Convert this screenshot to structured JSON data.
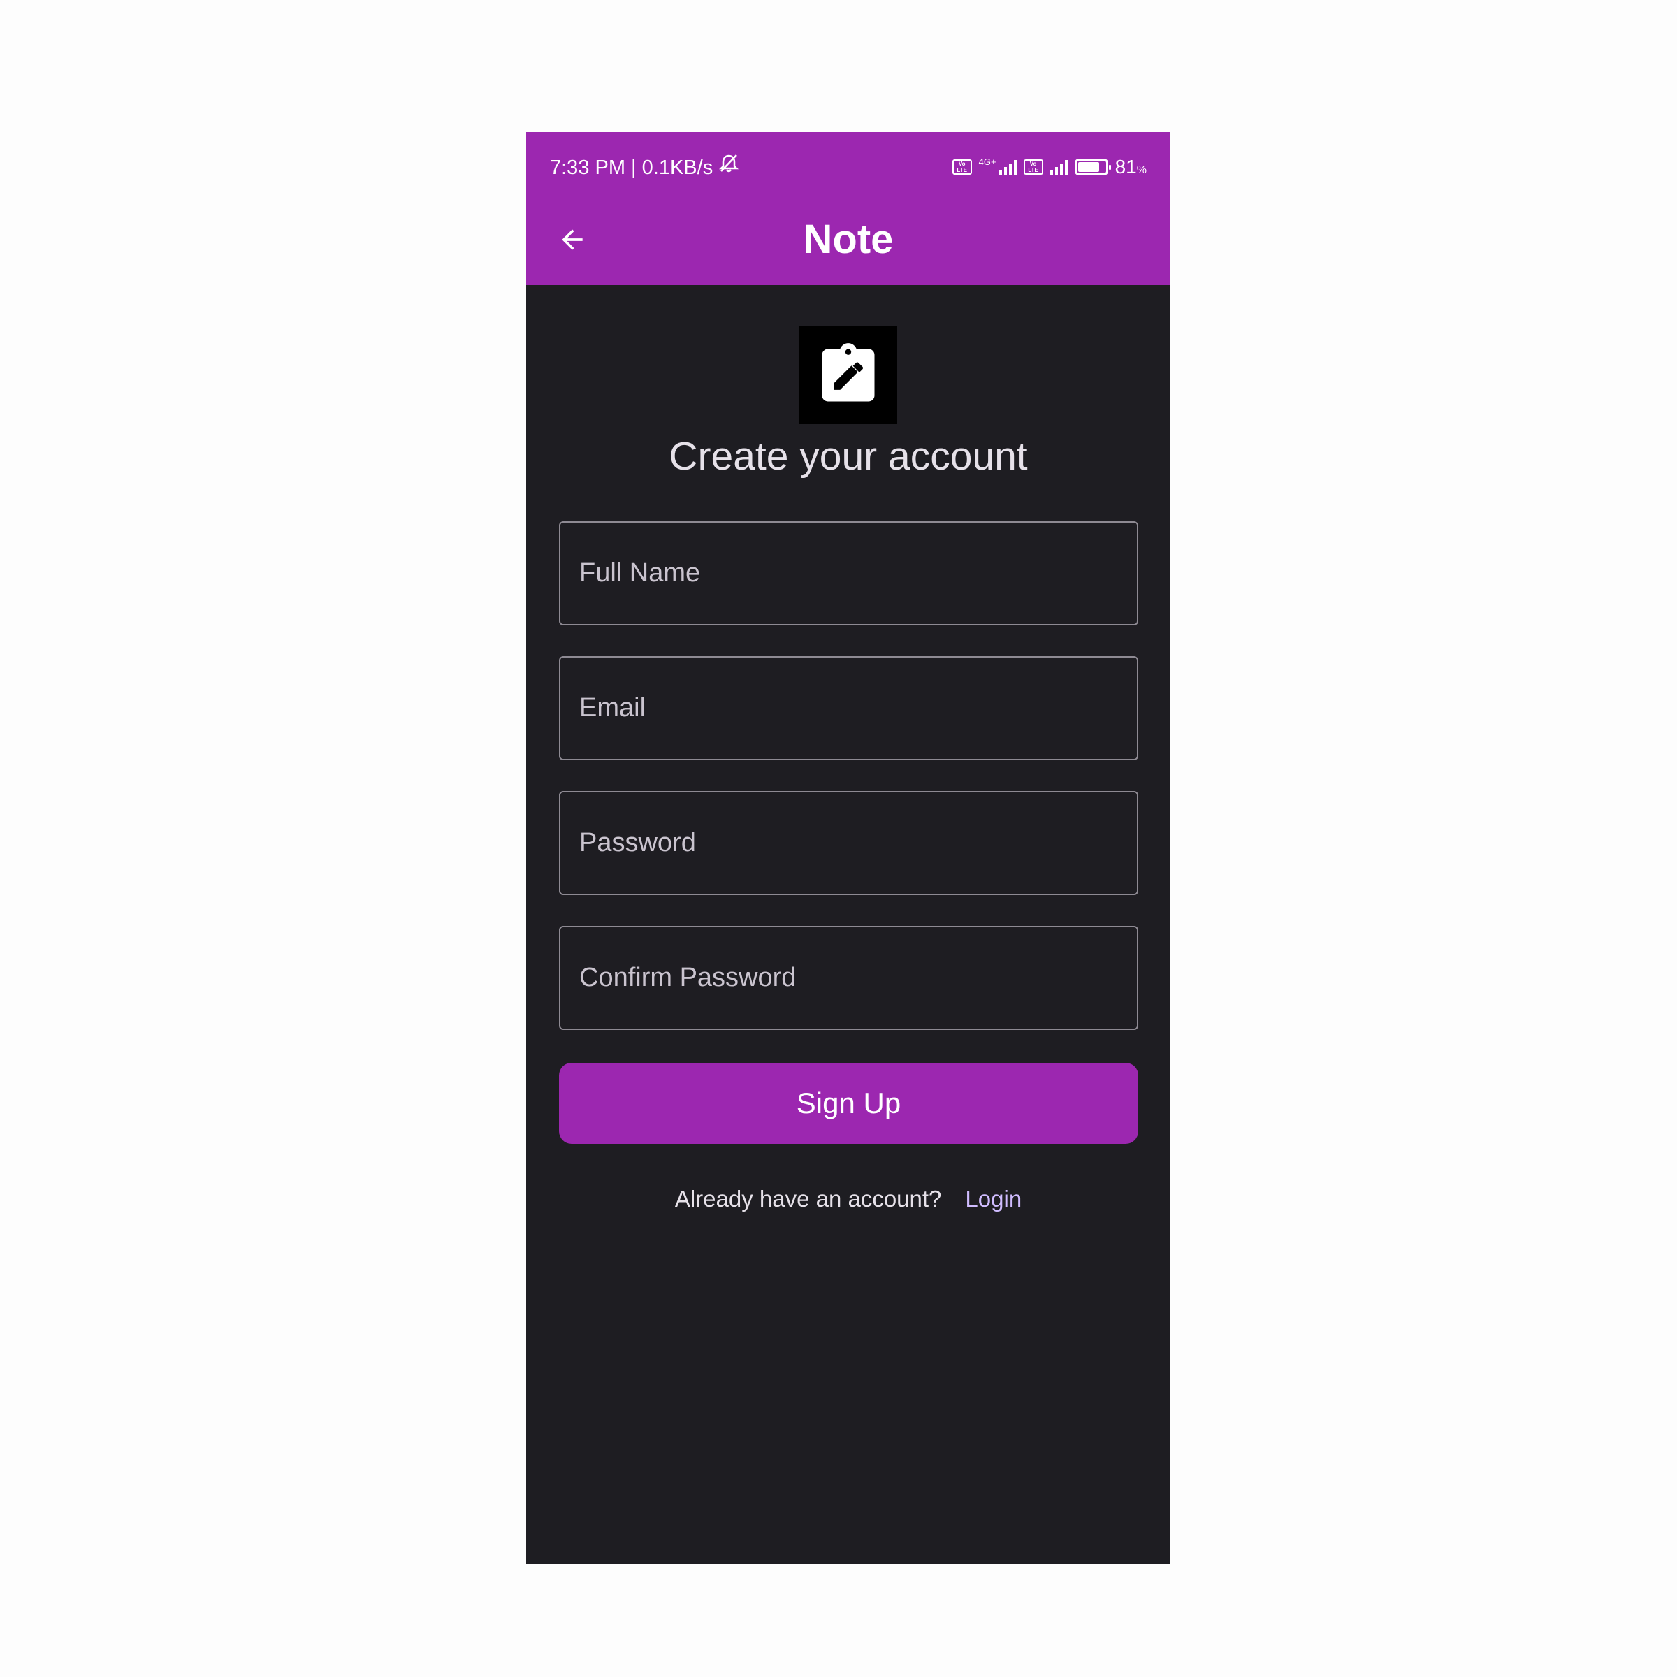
{
  "status_bar": {
    "time_info": "7:33 PM | 0.1KB/s",
    "network_type": "4G+",
    "battery": "81",
    "battery_unit": "%",
    "battery_level": 0.81,
    "icons": [
      "mute-alarm-icon",
      "volte-icon",
      "signal-icon",
      "volte-icon",
      "signal-icon",
      "battery-icon"
    ]
  },
  "app_bar": {
    "title": "Note",
    "back_icon": "arrow-back-icon",
    "color": "#9c27b0"
  },
  "logo": {
    "icon": "clipboard-edit-icon"
  },
  "form": {
    "heading": "Create your account",
    "full_name_placeholder": "Full Name",
    "email_placeholder": "Email",
    "password_placeholder": "Password",
    "confirm_password_placeholder": "Confirm Password",
    "signup_label": "Sign Up"
  },
  "footer": {
    "prompt": "Already have an account?",
    "login_label": "Login"
  },
  "colors": {
    "accent": "#9c27b0",
    "background": "#1e1d22",
    "link": "#d0bcff"
  }
}
